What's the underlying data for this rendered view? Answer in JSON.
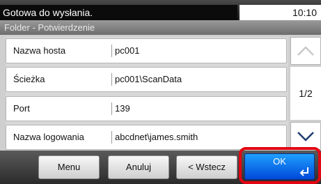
{
  "status": {
    "message": "Gotowa do wysłania.",
    "time": "10:10"
  },
  "screen": {
    "title": "Folder - Potwierdzenie"
  },
  "fields": [
    {
      "label": "Nazwa hosta",
      "value": "pc001"
    },
    {
      "label": "Ścieżka",
      "value": "pc001\\ScanData"
    },
    {
      "label": "Port",
      "value": "139"
    },
    {
      "label": "Nazwa logowania",
      "value": "abcdnet\\james.smith"
    }
  ],
  "pagination": {
    "indicator": "1/2"
  },
  "buttons": {
    "menu": "Menu",
    "cancel": "Anuluj",
    "back": "< Wstecz",
    "ok": "OK"
  },
  "icons": {
    "scroll_up": "chevron-up-icon",
    "scroll_down": "chevron-down-icon",
    "enter": "enter-arrow-icon"
  },
  "colors": {
    "ok_button": "#0a6cf0",
    "ok_highlight": "#e30613"
  }
}
